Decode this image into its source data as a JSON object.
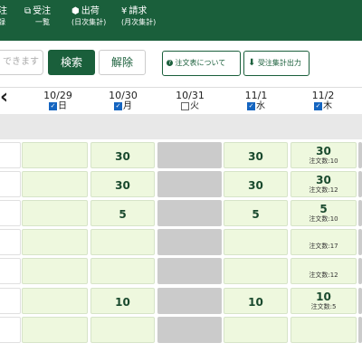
{
  "header": {
    "nav": [
      {
        "icon": "",
        "label": "注",
        "sub": "録"
      },
      {
        "icon": "⧉",
        "label": "受注",
        "sub": "一覧"
      },
      {
        "icon": "⬢",
        "label": "出荷",
        "sub": "(日次集計)"
      },
      {
        "icon": "¥",
        "label": "請求",
        "sub": "(月次集計)"
      }
    ]
  },
  "toolbar": {
    "search_placeholder": "できます",
    "search_label": "検索",
    "clear_label": "解除",
    "order_table_label": "注文表について",
    "export_label": "受注集計出力"
  },
  "dates": [
    {
      "date": "10/29",
      "dow": "日",
      "checked": true
    },
    {
      "date": "10/30",
      "dow": "月",
      "checked": true
    },
    {
      "date": "10/31",
      "dow": "火",
      "checked": false
    },
    {
      "date": "11/1",
      "dow": "水",
      "checked": true
    },
    {
      "date": "11/2",
      "dow": "木",
      "checked": true
    }
  ],
  "rows": [
    [
      {
        "qty": ""
      },
      {
        "qty": "30"
      },
      {
        "qty": "",
        "gray": true
      },
      {
        "qty": "30"
      },
      {
        "qty": "30",
        "count": "注文数:10"
      }
    ],
    [
      {
        "qty": ""
      },
      {
        "qty": "30"
      },
      {
        "qty": "",
        "gray": true
      },
      {
        "qty": "30"
      },
      {
        "qty": "30",
        "count": "注文数:12"
      }
    ],
    [
      {
        "qty": ""
      },
      {
        "qty": "5"
      },
      {
        "qty": "",
        "gray": true
      },
      {
        "qty": "5"
      },
      {
        "qty": "5",
        "count": "注文数:10"
      }
    ],
    [
      {
        "qty": ""
      },
      {
        "qty": ""
      },
      {
        "qty": "",
        "gray": true
      },
      {
        "qty": ""
      },
      {
        "qty": "",
        "count": "注文数:17"
      }
    ],
    [
      {
        "qty": ""
      },
      {
        "qty": ""
      },
      {
        "qty": "",
        "gray": true
      },
      {
        "qty": ""
      },
      {
        "qty": "",
        "count": "注文数:12"
      }
    ],
    [
      {
        "qty": ""
      },
      {
        "qty": "10"
      },
      {
        "qty": "",
        "gray": true
      },
      {
        "qty": "10"
      },
      {
        "qty": "10",
        "count": "注文数:5"
      }
    ],
    [
      {
        "qty": ""
      },
      {
        "qty": ""
      },
      {
        "qty": "",
        "gray": true
      },
      {
        "qty": ""
      },
      {
        "qty": ""
      }
    ]
  ],
  "colors": {
    "brand": "#1a5f3b",
    "cell": "#eef8de",
    "closed": "#cbcbcb",
    "check": "#1565c0"
  }
}
